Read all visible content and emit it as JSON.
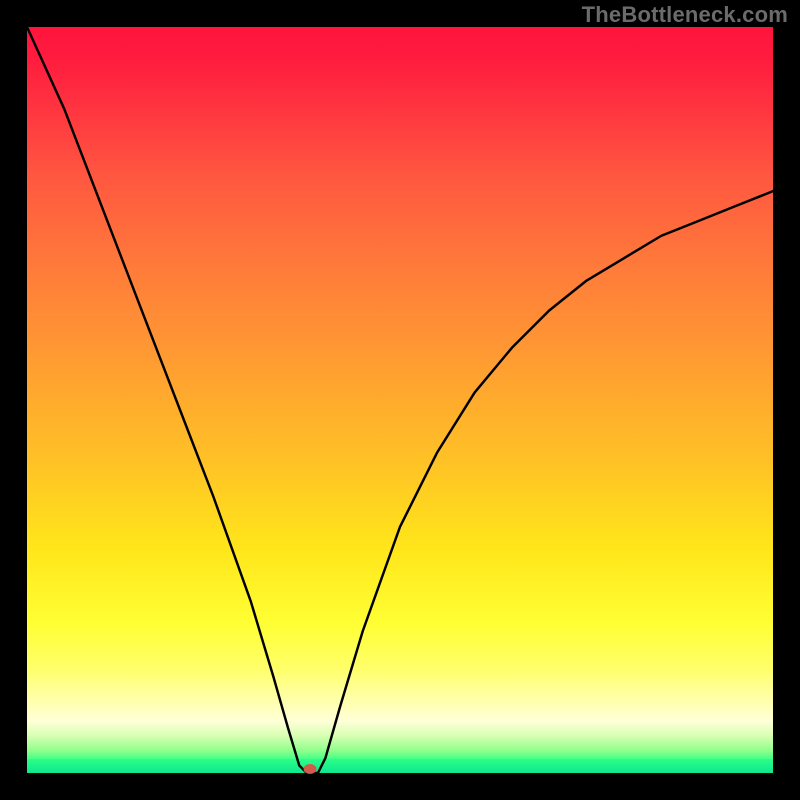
{
  "watermark": "TheBottleneck.com",
  "chart_data": {
    "type": "line",
    "title": "",
    "xlabel": "",
    "ylabel": "",
    "xlim": [
      0,
      100
    ],
    "ylim": [
      0,
      100
    ],
    "grid": false,
    "legend": false,
    "minimum_x": 38,
    "marker": {
      "x": 38,
      "y": 0,
      "color": "#d35b4c"
    },
    "background_gradient_top_color": "#ff143c",
    "background_gradient_bottom_color": "#0ee690",
    "curve_points": [
      {
        "x": 0,
        "y": 100
      },
      {
        "x": 5,
        "y": 89
      },
      {
        "x": 10,
        "y": 76
      },
      {
        "x": 15,
        "y": 63
      },
      {
        "x": 20,
        "y": 50
      },
      {
        "x": 25,
        "y": 37
      },
      {
        "x": 30,
        "y": 23
      },
      {
        "x": 33,
        "y": 13
      },
      {
        "x": 35,
        "y": 6
      },
      {
        "x": 36.5,
        "y": 1
      },
      {
        "x": 37.5,
        "y": 0
      },
      {
        "x": 39,
        "y": 0
      },
      {
        "x": 40,
        "y": 2
      },
      {
        "x": 42,
        "y": 9
      },
      {
        "x": 45,
        "y": 19
      },
      {
        "x": 50,
        "y": 33
      },
      {
        "x": 55,
        "y": 43
      },
      {
        "x": 60,
        "y": 51
      },
      {
        "x": 65,
        "y": 57
      },
      {
        "x": 70,
        "y": 62
      },
      {
        "x": 75,
        "y": 66
      },
      {
        "x": 80,
        "y": 69
      },
      {
        "x": 85,
        "y": 72
      },
      {
        "x": 90,
        "y": 74
      },
      {
        "x": 95,
        "y": 76
      },
      {
        "x": 100,
        "y": 78
      }
    ]
  }
}
